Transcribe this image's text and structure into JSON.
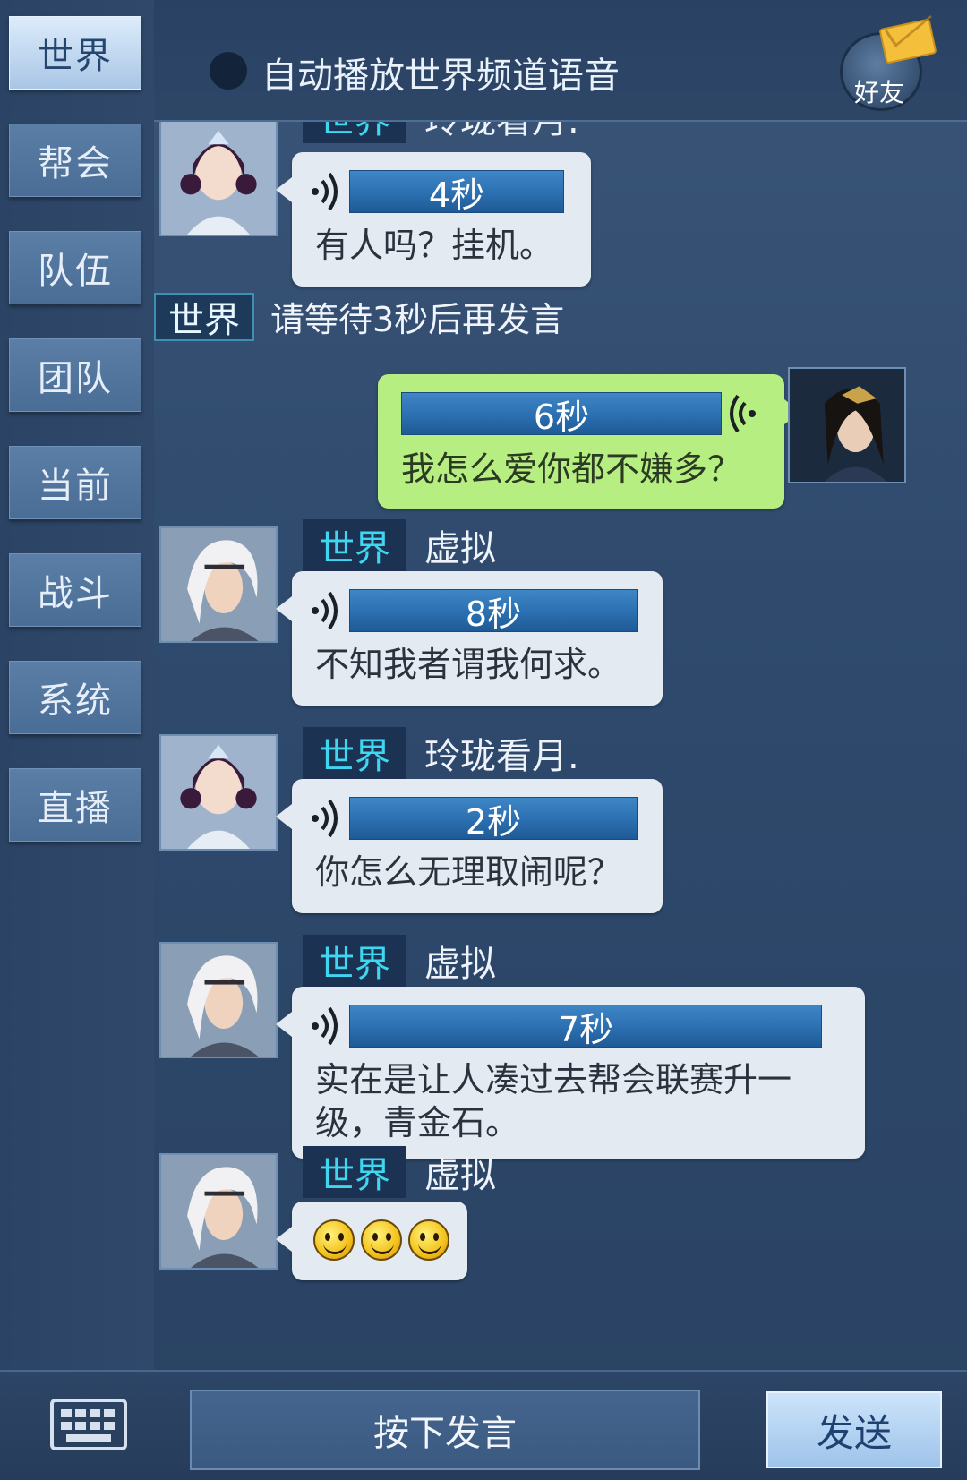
{
  "channels": [
    "世界",
    "帮会",
    "队伍",
    "团队",
    "当前",
    "战斗",
    "系统",
    "直播"
  ],
  "active_channel": "世界",
  "topbar": {
    "auto_play_label": "自动播放世界频道语音",
    "friend_label": "好友"
  },
  "partial_top": {
    "channel": "世界",
    "sender": "玲珑看月."
  },
  "messages": [
    {
      "voice": "4秒",
      "text": "有人吗？挂机。"
    },
    {
      "channel": "世界",
      "system_text": "请等待3秒后再发言"
    },
    {
      "voice": "6秒",
      "text": "我怎么爱你都不嫌多？"
    },
    {
      "channel": "世界",
      "sender": "虚拟",
      "voice": "8秒",
      "text": "不知我者谓我何求。"
    },
    {
      "channel": "世界",
      "sender": "玲珑看月.",
      "voice": "2秒",
      "text": "你怎么无理取闹呢？"
    },
    {
      "channel": "世界",
      "sender": "虚拟",
      "voice": "7秒",
      "text_line1": "实在是让人凑过去帮会联赛升一",
      "text_line2": "级，青金石。"
    },
    {
      "channel": "世界",
      "sender": "虚拟"
    }
  ],
  "bottombar": {
    "push_to_talk": "按下发言",
    "send": "发送"
  },
  "icons": [
    "keyboard-icon",
    "voice-wave-icon",
    "mail-icon",
    "smile-emoji-icon"
  ],
  "colors": {
    "accent_cyan": "#3fd7f0",
    "bubble_mine": "#b7ee82",
    "bubble_other": "#e4eaf1",
    "voice_bar": "#2b6fb0"
  }
}
